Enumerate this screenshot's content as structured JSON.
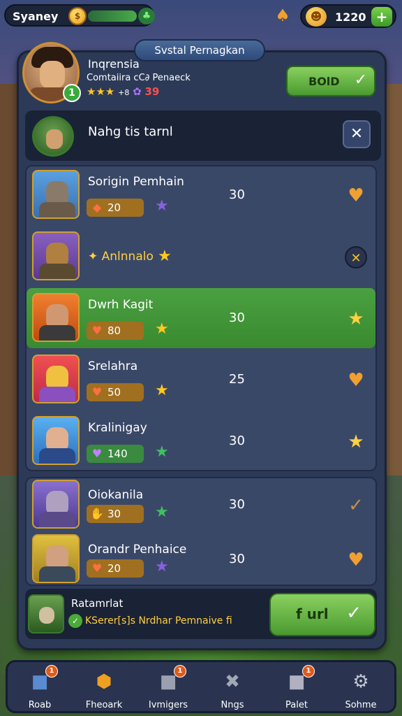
{
  "topbar": {
    "location": "Syaney",
    "coin_glyph": "$",
    "gem_glyph": "♣",
    "bell_icon": "bell-icon",
    "resource_value": "1220",
    "add_label": "+"
  },
  "panel": {
    "title": "Svstal Pernagkan",
    "player": {
      "level": "1",
      "name": "Inqrensia",
      "subtitle": "Comtaiira cC∂ Penaeck",
      "stars": "★★★",
      "star_num": "+8",
      "gem_icon": "✿",
      "red_num": "39"
    },
    "top_button": {
      "label": "BOlD",
      "check": "✓"
    },
    "search": {
      "text": "Nahg tis tarnl",
      "close": "✕"
    },
    "group1": [
      {
        "name": "Sorigin Pemhain",
        "stat_icon": "◆",
        "stat_val": "20",
        "star": "★",
        "star_color": "#8a60e0",
        "score": "30",
        "end": "♥",
        "end_color": "#f0a030",
        "theme": "wolf"
      },
      {
        "name": "Anlnnalo",
        "name_prefix": "✦",
        "star": "★",
        "star_color": "#ffc820",
        "score": "",
        "end": "✕",
        "end_color": "#f0c030",
        "theme": "beast"
      },
      {
        "name": "Dwrh Kagit",
        "stat_icon": "♥",
        "stat_val": "80",
        "star": "★",
        "star_color": "#ffc820",
        "score": "30",
        "end": "★",
        "end_color": "#ffd040",
        "theme": "warrior",
        "selected": true
      },
      {
        "name": "Srelahra",
        "stat_icon": "♥",
        "stat_val": "50",
        "star": "★",
        "star_color": "#ffc820",
        "score": "25",
        "end": "♥",
        "end_color": "#f0a030",
        "theme": "fox"
      },
      {
        "name": "Kralinigay",
        "stat_icon": "♥",
        "stat_val": "140",
        "star": "★",
        "star_color": "#40c060",
        "score": "30",
        "end": "★",
        "end_color": "#ffd040",
        "theme": "soldier"
      }
    ],
    "group2": [
      {
        "name": "Oiokanila",
        "stat_icon": "✋",
        "stat_val": "30",
        "star": "★",
        "star_color": "#40c060",
        "score": "30",
        "end": "✓",
        "end_color": "#c09050",
        "theme": "witch"
      },
      {
        "name": "Orandr Penhaice",
        "stat_icon": "♥",
        "stat_val": "20",
        "star": "★",
        "star_color": "#8a60e0",
        "score": "30",
        "end": "♥",
        "end_color": "#f0a030",
        "theme": "rogue"
      }
    ],
    "footer": {
      "title": "Ratamrlat",
      "subtitle": "KSerer[s]s Nrdhar Pemnaive fi",
      "check": "✓",
      "button_label": "f url",
      "button_check": "✓"
    }
  },
  "bottom_nav": [
    {
      "label": "Roab",
      "icon": "cube-icon",
      "glyph": "■",
      "color": "#5a8ad0",
      "badge": "1"
    },
    {
      "label": "Fheoark",
      "icon": "shield-icon",
      "glyph": "⬢",
      "color": "#f0a020",
      "badge": ""
    },
    {
      "label": "Ivmigers",
      "icon": "box-icon",
      "glyph": "■",
      "color": "#9aa0b0",
      "badge": "1"
    },
    {
      "label": "Nngs",
      "icon": "swords-icon",
      "glyph": "✖",
      "color": "#a0a8b8",
      "badge": ""
    },
    {
      "label": "Palet",
      "icon": "chest-icon",
      "glyph": "■",
      "color": "#b0b0c0",
      "badge": "1"
    },
    {
      "label": "Sohme",
      "icon": "gear-icon",
      "glyph": "⚙",
      "color": "#c0c8d8",
      "badge": ""
    }
  ]
}
